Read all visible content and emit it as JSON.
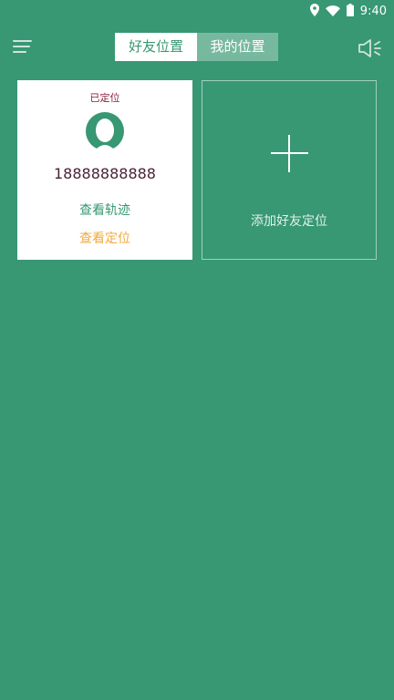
{
  "status_bar": {
    "time": "9:40",
    "icons": [
      "location-icon",
      "wifi-icon",
      "battery-icon"
    ]
  },
  "header": {
    "menu_icon": "menu-icon",
    "tabs": [
      {
        "label": "好友位置",
        "active": true
      },
      {
        "label": "我的位置",
        "active": false
      }
    ],
    "speaker_icon": "speaker-icon"
  },
  "friend_card": {
    "status": "已定位",
    "avatar_icon": "user-avatar-icon",
    "phone": "18888888888",
    "view_track": "查看轨迹",
    "view_location": "查看定位"
  },
  "add_card": {
    "icon": "plus-icon",
    "label": "添加好友定位"
  },
  "colors": {
    "background": "#379873",
    "accent_orange": "#f2a93b",
    "status_red": "#8a1f3a",
    "tab_inactive": "#77b99f"
  }
}
